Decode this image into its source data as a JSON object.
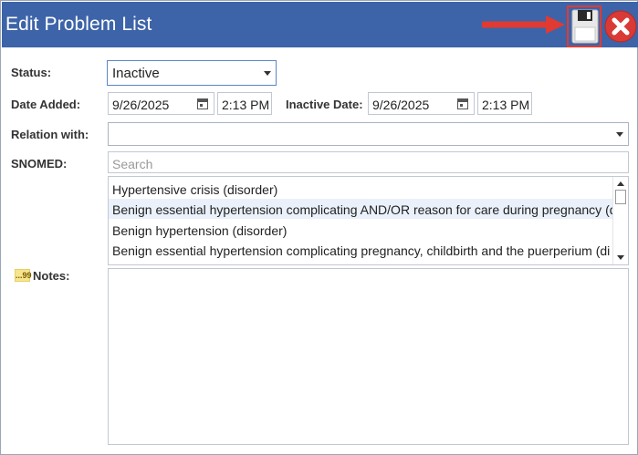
{
  "window": {
    "title": "Edit Problem List"
  },
  "status": {
    "label": "Status:",
    "value": "Inactive"
  },
  "date_added": {
    "label": "Date Added:",
    "date": "9/26/2025",
    "time": "2:13 PM"
  },
  "inactive_date": {
    "label": "Inactive Date:",
    "date": "9/26/2025",
    "time": "2:13 PM"
  },
  "relation": {
    "label": "Relation with:",
    "value": ""
  },
  "snomed": {
    "label": "SNOMED:",
    "placeholder": "Search",
    "results": [
      "Hypertensive crisis (disorder)",
      "Benign essential hypertension complicating AND/OR reason for care during pregnancy (d",
      "Benign hypertension (disorder)",
      "Benign essential hypertension complicating pregnancy, childbirth and the puerperium (di"
    ]
  },
  "notes": {
    "label": "Notes:",
    "icon_text": "...99",
    "value": ""
  },
  "colors": {
    "titlebar": "#3d64a8",
    "highlight_border": "#e03a32",
    "close_button": "#d93a35",
    "selected_row": "#eaf1fa"
  },
  "icons": {
    "save": "floppy-disk-icon",
    "close": "close-x-icon",
    "pointer": "red-arrow-annotation-icon"
  }
}
